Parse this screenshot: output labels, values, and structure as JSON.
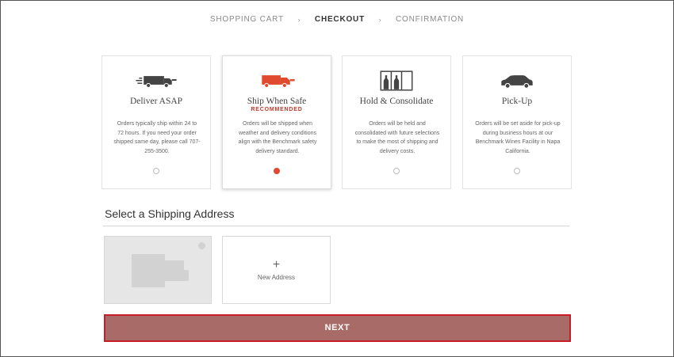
{
  "steps": [
    {
      "label": "SHOPPING CART"
    },
    {
      "label": "CHECKOUT"
    },
    {
      "label": "CONFIRMATION"
    }
  ],
  "step_separator": "›",
  "delivery_options": [
    {
      "title": "Deliver ASAP",
      "badge": "",
      "description": "Orders typically ship within 24 to 72 hours. If you need your order shipped same day, please call 707-255-3500.",
      "selected": false,
      "icon": "fast-truck-icon"
    },
    {
      "title": "Ship When Safe",
      "badge": "RECOMMENDED",
      "description": "Orders will be shipped when weather and delivery conditions align with the Benchmark safety delivery standard.",
      "selected": true,
      "icon": "truck-icon"
    },
    {
      "title": "Hold & Consolidate",
      "badge": "",
      "description": "Orders will be held and consolidated with future selections to make the most of shipping and delivery costs.",
      "selected": false,
      "icon": "wine-rack-icon"
    },
    {
      "title": "Pick-Up",
      "badge": "",
      "description": "Orders will be set aside for pick-up during business hours at our Benchmark Wines Facility in Napa California.",
      "selected": false,
      "icon": "car-icon"
    }
  ],
  "shipping_address": {
    "section_title": "Select a Shipping Address",
    "new_address_plus": "+",
    "new_address_label": "New Address"
  },
  "next_label": "NEXT",
  "colors": {
    "accent": "#e04a2f",
    "badge": "#c0392b",
    "button": "#a86b68",
    "button_border": "#c81c26"
  }
}
